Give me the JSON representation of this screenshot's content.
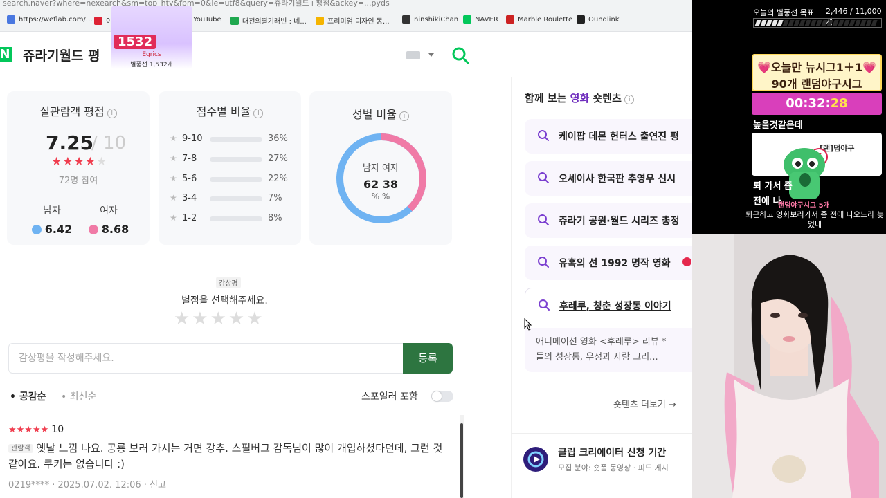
{
  "browser": {
    "url": "search.naver?where=nexearch&sm=top_hty&fbm=0&ie=utf8&query=쥬라기월드+평점&ackey=...pyds",
    "bookmarks": [
      {
        "label": "https://weflab.com/...",
        "color": "#4a78e0"
      },
      {
        "label": "이",
        "color": "#d23"
      },
      {
        "label": "YouTube",
        "color": "#e22"
      },
      {
        "label": "대천의딸기래빈 : 네...",
        "color": "#1fa84f"
      },
      {
        "label": "프리미엄 디자인 동...",
        "color": "#f5b400"
      },
      {
        "label": "ninshikiChan",
        "color": "#333"
      },
      {
        "label": "NAVER",
        "color": "#03c75a"
      },
      {
        "label": "Marble Roulette",
        "color": "#c22"
      },
      {
        "label": "Oundlink",
        "color": "#222"
      }
    ]
  },
  "search": {
    "logo": "N",
    "query": "쥬라기월드 평"
  },
  "ratings": {
    "avg_title": "실관람객 평점",
    "score": "7.25",
    "score_max": "/ 10",
    "stars": "★★★★",
    "stars_empty": "★",
    "participants": "72명 참여",
    "male_label": "남자",
    "male_score": "6.42",
    "female_label": "여자",
    "female_score": "8.68",
    "dist_title": "점수별 비율",
    "distribution": [
      {
        "range": "9-10",
        "pct": "36%",
        "value": 36,
        "color": "#f03e4f"
      },
      {
        "range": "7-8",
        "pct": "27%",
        "value": 27,
        "color": "#f7a3ac"
      },
      {
        "range": "5-6",
        "pct": "22%",
        "value": 22,
        "color": "#f7a3ac"
      },
      {
        "range": "3-4",
        "pct": "7%",
        "value": 7,
        "color": "#f7a3ac"
      },
      {
        "range": "1-2",
        "pct": "8%",
        "value": 8,
        "color": "#f7a3ac"
      }
    ],
    "gender_title": "성별 비율",
    "male_pct": 62,
    "female_pct": 38,
    "donut_labels": "남자  여자",
    "donut_values": "62  38",
    "donut_units": "%  %",
    "male_color": "#6fb3f2",
    "female_color": "#f07aa6"
  },
  "review_form": {
    "tag": "감상평",
    "prompt": "별점을 선택해주세요.",
    "stars": "★★★★★",
    "placeholder": "감상평을 작성해주세요.",
    "submit": "등록",
    "sort_popular": "• 공감순",
    "sort_recent": "• 최신순",
    "spoiler": "스포일러 포함"
  },
  "reviews": [
    {
      "stars": "★★★★★",
      "score": "10",
      "badge": "관람객",
      "text": "옛날 느낌 나요. 공룡 보러 가시는 거면 강추. 스필버그 감독님이 많이 개입하셨다던데, 그런 것 같아요. 쿠키는 없습니다 :)",
      "meta": "0219****  ·  2025.07.02. 12:06  ·  신고"
    }
  ],
  "shorts": {
    "title_pre": "함께 보는 ",
    "title_hl": "영화",
    "title_post": " 숏텐츠",
    "items": [
      "케이팝 데몬 헌터스 출연진 평",
      "오세이사 한국판 추영우 신시",
      "쥬라기 공원·월드 시리즈 총정",
      "유혹의 선 1992 명작 영화",
      "후레루, 청춘 성장통 이야기"
    ],
    "desc_l1": "애니메이션 영화 <후레루> 리뷰 *",
    "desc_l2": "들의 성장통, 우정과 사랑 그리...",
    "more": "숏텐츠 더보기 →",
    "clip_title": "클립 크리에이터 신청 기간",
    "clip_sub": "모집 분야: 숏폼 동영상 · 피드 게시"
  },
  "donation": {
    "amount": "1532",
    "name": "Egrics",
    "desc": "별풍선 1,532개"
  },
  "stream": {
    "goal_label": "오늘의 별풍선 목표",
    "goal_value": "2,446 / 11,000개",
    "goal_fraction": 0.22,
    "promo_l1": "💗오늘만 뉴시그1＋1💗",
    "promo_l2": "90개 랜덤야구시그",
    "timer_main": "00:32:",
    "timer_sec": "28",
    "chat1": "높을것같은데",
    "gift_text": "[랜]덤야구",
    "gift_num": "5",
    "chat_a": "퇴                가서 좀",
    "chat_b": "전에 나",
    "gift_line": "랜덤야구시그 5개",
    "chat_c": "퇴근하고 영화보러가서 좀 전에 나오느라 늦었네"
  }
}
